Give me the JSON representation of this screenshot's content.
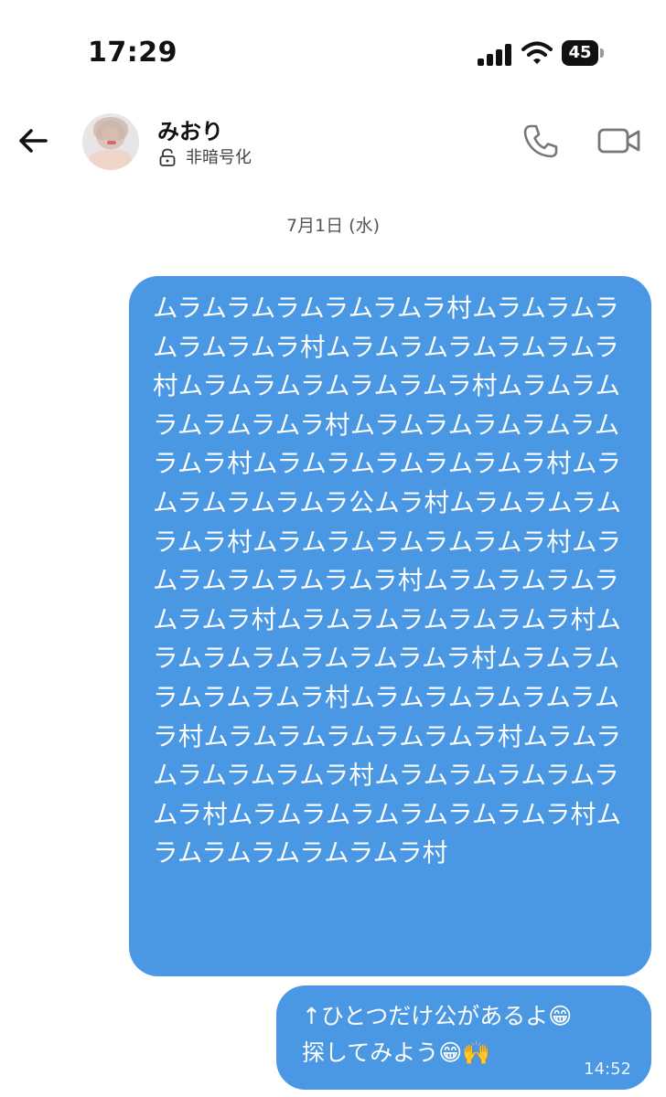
{
  "status_bar": {
    "time": "17:29",
    "battery": "45"
  },
  "header": {
    "contact_name": "みおり",
    "encryption_status": "非暗号化",
    "icons": [
      "back-arrow-icon",
      "avatar",
      "lock-icon",
      "phone-icon",
      "video-camera-icon"
    ]
  },
  "date_separator": "7月1日 (水)",
  "messages": [
    {
      "text": "ムラムラムラムラムラムラ村ムラムラムラムラムラムラ村ムラムラムラムラムラムラ村ムラムラムラムラムラムラ村ムラムラムラムラムラムラ村ムラムラムラムラムラムラムラ村ムラムラムラムラムラムラ村ムラムラムラムラムラ公ムラ村ムラムラムラムラムラ村ムラムラムラムラムラムラ村ムラムラムラムラムラムラ村ムラムラムラムラムラムラ村ムラムラムラムラムラムラ村ムラムラムラムラムラムラムラ村ムラムラムラムラムラムラ村ムラムラムラムラムラムラ村ムラムラムラムラムラムラ村ムラムラムラムラムラムラ村ムラムラムラムラムラムラ村ムラムラムラムラムラムラムラ村ムラムラムラムラムラムラ村"
    },
    {
      "text": "↑ひとつだけ公があるよ😁\n探してみよう😁🙌",
      "time": "14:52"
    }
  ],
  "colors": {
    "bubble": "#4a97e4",
    "background": "#ffffff"
  }
}
